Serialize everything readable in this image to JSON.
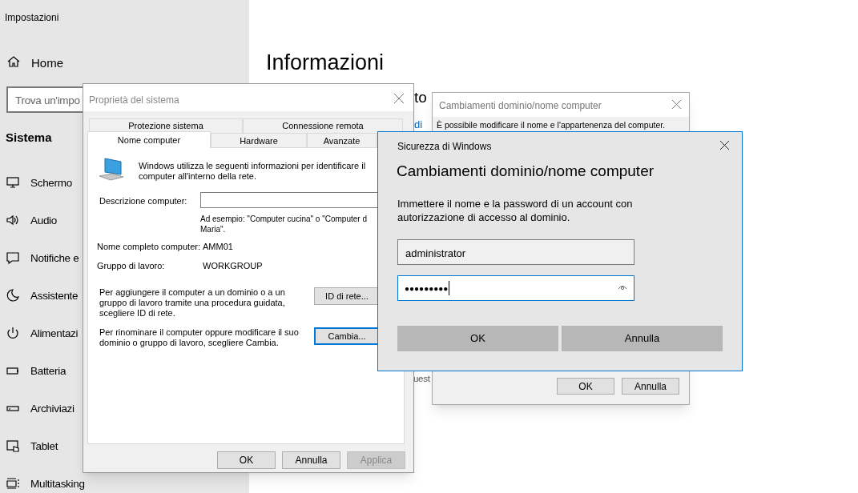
{
  "settings": {
    "title": "Impostazioni",
    "home": "Home",
    "search": {
      "placeholder": "Trova un'impo"
    },
    "section": "Sistema",
    "items": [
      {
        "label": "Schermo"
      },
      {
        "label": "Audio"
      },
      {
        "label": "Notifiche e"
      },
      {
        "label": "Assistente"
      },
      {
        "label": "Alimentazi"
      },
      {
        "label": "Batteria"
      },
      {
        "label": "Archiviazi"
      },
      {
        "label": "Tablet"
      },
      {
        "label": "Multitasking"
      }
    ],
    "page_title": "Informazioni",
    "fragment_1": "to",
    "link_fragment": "di",
    "fragment_2": "uest"
  },
  "system_properties": {
    "title": "Proprietà del sistema",
    "tabs_back": [
      {
        "label": "Protezione sistema",
        "selected": false
      },
      {
        "label": "Connessione remota",
        "selected": false
      }
    ],
    "tabs_front": [
      {
        "label": "Nome computer",
        "selected": true
      },
      {
        "label": "Hardware",
        "selected": false
      },
      {
        "label": "Avanzate",
        "selected": false
      }
    ],
    "intro": "Windows utilizza le seguenti informazioni per identificare il computer all'interno della rete.",
    "description_label": "Descrizione computer:",
    "example": "Ad esempio: \"Computer cucina\" o \"Computer d\nMaria\".",
    "full_name_label": "Nome completo computer:",
    "full_name": "AMM01",
    "workgroup_label": "Gruppo di lavoro:",
    "workgroup": "WORKGROUP",
    "network_text": "Per aggiungere il computer a un dominio o a un gruppo di lavoro tramite una procedura guidata, scegliere ID di rete.",
    "network_button": "ID di rete...",
    "rename_text": "Per rinominare il computer oppure modificare il suo dominio o gruppo di lavoro, scegliere Cambia.",
    "rename_button": "Cambia...",
    "buttons": [
      {
        "label": "OK",
        "disabled": false
      },
      {
        "label": "Annulla",
        "disabled": false
      },
      {
        "label": "Applica",
        "disabled": true
      }
    ]
  },
  "domain_changes": {
    "title": "Cambiamenti dominio/nome computer",
    "text": "È possibile modificare il nome e l'appartenenza del computer.",
    "buttons": [
      "OK",
      "Annulla"
    ]
  },
  "security": {
    "title": "Sicurezza di Windows",
    "heading": "Cambiamenti dominio/nome computer",
    "text": "Immettere il nome e la password di un account con autorizzazione di accesso al dominio.",
    "username": "administrator",
    "password": "●●●●●●●●●",
    "buttons": [
      "OK",
      "Annulla"
    ]
  }
}
